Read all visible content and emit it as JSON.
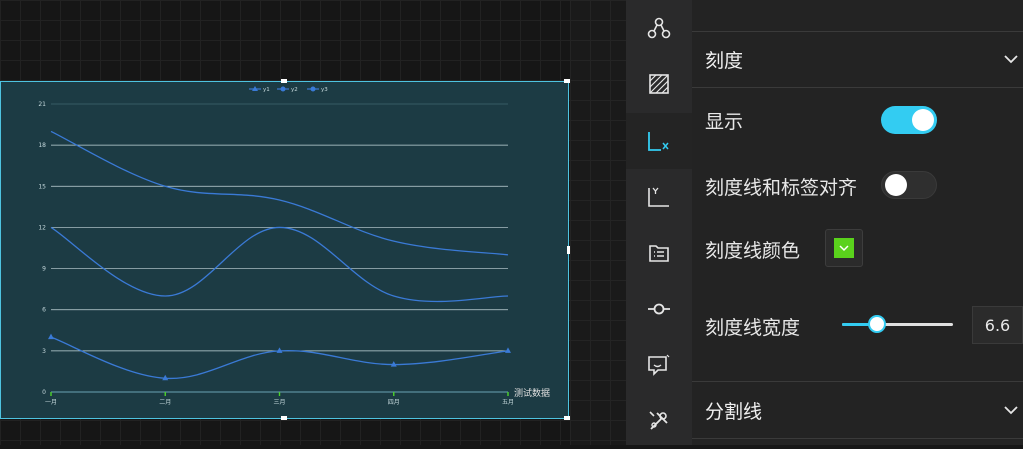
{
  "chart_data": {
    "type": "line",
    "categories": [
      "一月",
      "二月",
      "三月",
      "四月",
      "五月"
    ],
    "series": [
      {
        "name": "y1",
        "marker": "triangle",
        "values": [
          4,
          1,
          3,
          2,
          3
        ]
      },
      {
        "name": "y2",
        "marker": "circle",
        "values": [
          12,
          7,
          12,
          7,
          7
        ]
      },
      {
        "name": "y3",
        "marker": "circle",
        "values": [
          19,
          15,
          14,
          11,
          10
        ]
      }
    ],
    "xlabel": "测试数据",
    "ylim": [
      0,
      21
    ],
    "yticks": [
      0,
      3,
      6,
      9,
      12,
      15,
      18,
      21
    ],
    "grid": true,
    "legend_position": "top-center",
    "line_color": "#3a7ad6",
    "tick_color": "#4dd32b"
  },
  "rail": {
    "icons": [
      "nodes-icon",
      "texture-icon",
      "x-axis-icon",
      "y-axis-icon",
      "legend-list-icon",
      "axis-pointer-icon",
      "tooltip-icon",
      "tools-icon"
    ],
    "active": "x-axis-icon"
  },
  "panel": {
    "section_tick": "刻度",
    "show_label": "显示",
    "show_on": true,
    "align_label": "刻度线和标签对齐",
    "align_on": false,
    "color_label": "刻度线颜色",
    "color_value": "#5ad21c",
    "width_label": "刻度线宽度",
    "width_value": "6.6",
    "width_fraction": 0.33,
    "section_split": "分割线"
  },
  "colors": {
    "accent": "#33ccf2",
    "chart_bg": "#1c3b44",
    "selection_border": "#4ec3e0"
  }
}
